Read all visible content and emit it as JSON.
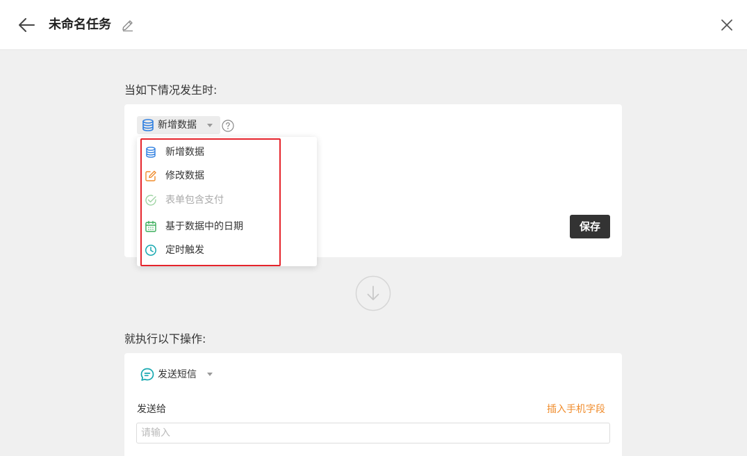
{
  "header": {
    "title": "未命名任务"
  },
  "trigger": {
    "section_label": "当如下情况发生时:",
    "selected_label": "新增数据",
    "options": [
      {
        "label": "新增数据",
        "icon": "database-icon",
        "color": "#2f7fe0",
        "disabled": false
      },
      {
        "label": "修改数据",
        "icon": "edit-icon",
        "color": "#f08c2c",
        "disabled": false
      },
      {
        "label": "表单包含支付",
        "icon": "check-circle-icon",
        "color": "#9fd4a4",
        "disabled": true
      },
      {
        "label": "基于数据中的日期",
        "icon": "calendar-icon",
        "color": "#3cae5c",
        "disabled": false
      },
      {
        "label": "定时触发",
        "icon": "clock-icon",
        "color": "#16a8b0",
        "disabled": false
      }
    ],
    "save_label": "保存"
  },
  "action": {
    "section_label": "就执行以下操作:",
    "selected_label": "发送短信",
    "icon": "message-icon",
    "icon_color": "#16a8b0",
    "recipient": {
      "label": "发送给",
      "insert_link": "插入手机字段",
      "placeholder": "请输入",
      "value": ""
    }
  },
  "colors": {
    "accent_orange": "#f08c2c",
    "highlight_red": "#e5232b",
    "primary_button": "#333333",
    "background": "#f0f0f0"
  }
}
